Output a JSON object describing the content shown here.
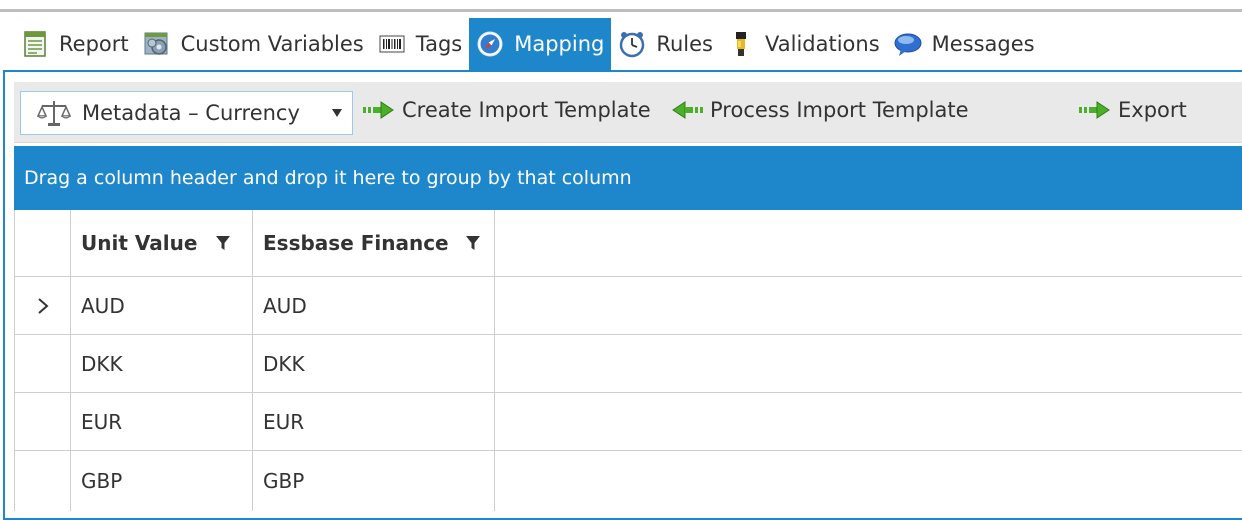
{
  "tabs": [
    {
      "label": "Report",
      "icon": "report-icon"
    },
    {
      "label": "Custom Variables",
      "icon": "gears-icon"
    },
    {
      "label": "Tags",
      "icon": "barcode-icon"
    },
    {
      "label": "Mapping",
      "icon": "compass-icon",
      "active": true
    },
    {
      "label": "Rules",
      "icon": "clock-icon"
    },
    {
      "label": "Validations",
      "icon": "flashlight-icon"
    },
    {
      "label": "Messages",
      "icon": "speech-bubble-icon"
    }
  ],
  "toolbar": {
    "dropdown": {
      "value": "Metadata – Currency",
      "icon": "balance-scale-icon"
    },
    "create_label": "Create Import Template",
    "process_label": "Process Import Template",
    "export_label": "Export"
  },
  "group_panel": {
    "text": "Drag a column header and drop it here to group by that column"
  },
  "grid": {
    "columns": [
      "Unit Value",
      "Essbase Finance"
    ],
    "rows": [
      [
        "AUD",
        "AUD"
      ],
      [
        "DKK",
        "DKK"
      ],
      [
        "EUR",
        "EUR"
      ],
      [
        "GBP",
        "GBP"
      ]
    ]
  },
  "colors": {
    "accent": "#1e87cc",
    "toolbar_bg": "#e9e9e9",
    "grid_line": "#cfcfcf",
    "arrow_green": "#4caf2a"
  }
}
